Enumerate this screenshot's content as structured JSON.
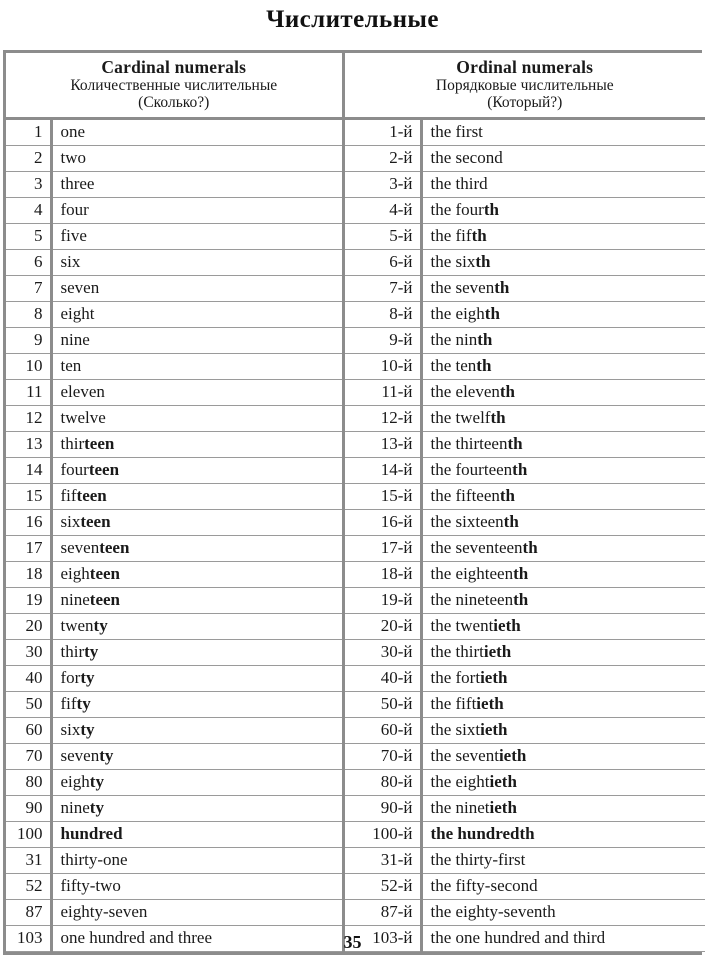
{
  "title": "Числительные",
  "page_number": "35",
  "colors": {
    "border_outer": "#8c8c8c",
    "border_inner": "#9a9a9a",
    "text": "#1a1a1a",
    "background": "#ffffff"
  },
  "table": {
    "headers": {
      "cardinal": {
        "en": "Cardinal numerals",
        "ru": "Количественные числительные",
        "ru_question": "(Сколько?)"
      },
      "ordinal": {
        "en": "Ordinal numerals",
        "ru": "Порядковые числительные",
        "ru_question": "(Который?)"
      }
    },
    "rows": [
      {
        "num": "1",
        "word_plain": "one",
        "word_bold": "",
        "onum": "1-й",
        "oword_plain": "the first",
        "oword_bold": "",
        "all_bold": false
      },
      {
        "num": "2",
        "word_plain": "two",
        "word_bold": "",
        "onum": "2-й",
        "oword_plain": "the second",
        "oword_bold": "",
        "all_bold": false
      },
      {
        "num": "3",
        "word_plain": "three",
        "word_bold": "",
        "onum": "3-й",
        "oword_plain": "the third",
        "oword_bold": "",
        "all_bold": false
      },
      {
        "num": "4",
        "word_plain": "four",
        "word_bold": "",
        "onum": "4-й",
        "oword_plain": "the four",
        "oword_bold": "th",
        "all_bold": false
      },
      {
        "num": "5",
        "word_plain": "five",
        "word_bold": "",
        "onum": "5-й",
        "oword_plain": "the fif",
        "oword_bold": "th",
        "all_bold": false
      },
      {
        "num": "6",
        "word_plain": "six",
        "word_bold": "",
        "onum": "6-й",
        "oword_plain": "the six",
        "oword_bold": "th",
        "all_bold": false
      },
      {
        "num": "7",
        "word_plain": "seven",
        "word_bold": "",
        "onum": "7-й",
        "oword_plain": "the seven",
        "oword_bold": "th",
        "all_bold": false
      },
      {
        "num": "8",
        "word_plain": "eight",
        "word_bold": "",
        "onum": "8-й",
        "oword_plain": "the eigh",
        "oword_bold": "th",
        "all_bold": false
      },
      {
        "num": "9",
        "word_plain": "nine",
        "word_bold": "",
        "onum": "9-й",
        "oword_plain": "the nin",
        "oword_bold": "th",
        "all_bold": false
      },
      {
        "num": "10",
        "word_plain": "ten",
        "word_bold": "",
        "onum": "10-й",
        "oword_plain": "the ten",
        "oword_bold": "th",
        "all_bold": false
      },
      {
        "num": "11",
        "word_plain": "eleven",
        "word_bold": "",
        "onum": "11-й",
        "oword_plain": "the eleven",
        "oword_bold": "th",
        "all_bold": false
      },
      {
        "num": "12",
        "word_plain": "twelve",
        "word_bold": "",
        "onum": "12-й",
        "oword_plain": "the twelf",
        "oword_bold": "th",
        "all_bold": false
      },
      {
        "num": "13",
        "word_plain": "thir",
        "word_bold": "teen",
        "onum": "13-й",
        "oword_plain": "the thirteen",
        "oword_bold": "th",
        "all_bold": false
      },
      {
        "num": "14",
        "word_plain": "four",
        "word_bold": "teen",
        "onum": "14-й",
        "oword_plain": "the fourteen",
        "oword_bold": "th",
        "all_bold": false
      },
      {
        "num": "15",
        "word_plain": "fif",
        "word_bold": "teen",
        "onum": "15-й",
        "oword_plain": "the fifteen",
        "oword_bold": "th",
        "all_bold": false
      },
      {
        "num": "16",
        "word_plain": "six",
        "word_bold": "teen",
        "onum": "16-й",
        "oword_plain": "the sixteen",
        "oword_bold": "th",
        "all_bold": false
      },
      {
        "num": "17",
        "word_plain": "seven",
        "word_bold": "teen",
        "onum": "17-й",
        "oword_plain": "the seventeen",
        "oword_bold": "th",
        "all_bold": false
      },
      {
        "num": "18",
        "word_plain": "eigh",
        "word_bold": "teen",
        "onum": "18-й",
        "oword_plain": "the eighteen",
        "oword_bold": "th",
        "all_bold": false
      },
      {
        "num": "19",
        "word_plain": "nine",
        "word_bold": "teen",
        "onum": "19-й",
        "oword_plain": "the nineteen",
        "oword_bold": "th",
        "all_bold": false
      },
      {
        "num": "20",
        "word_plain": "twen",
        "word_bold": "ty",
        "onum": "20-й",
        "oword_plain": "the twent",
        "oword_bold": "ieth",
        "all_bold": false
      },
      {
        "num": "30",
        "word_plain": "thir",
        "word_bold": "ty",
        "onum": "30-й",
        "oword_plain": "the thirt",
        "oword_bold": "ieth",
        "all_bold": false
      },
      {
        "num": "40",
        "word_plain": "for",
        "word_bold": "ty",
        "onum": "40-й",
        "oword_plain": "the fort",
        "oword_bold": "ieth",
        "all_bold": false
      },
      {
        "num": "50",
        "word_plain": "fif",
        "word_bold": "ty",
        "onum": "50-й",
        "oword_plain": "the fift",
        "oword_bold": "ieth",
        "all_bold": false
      },
      {
        "num": "60",
        "word_plain": "six",
        "word_bold": "ty",
        "onum": "60-й",
        "oword_plain": "the sixt",
        "oword_bold": "ieth",
        "all_bold": false
      },
      {
        "num": "70",
        "word_plain": "seven",
        "word_bold": "ty",
        "onum": "70-й",
        "oword_plain": "the sevent",
        "oword_bold": "ieth",
        "all_bold": false
      },
      {
        "num": "80",
        "word_plain": "eigh",
        "word_bold": "ty",
        "onum": "80-й",
        "oword_plain": "the eight",
        "oword_bold": "ieth",
        "all_bold": false
      },
      {
        "num": "90",
        "word_plain": "nine",
        "word_bold": "ty",
        "onum": "90-й",
        "oword_plain": "the ninet",
        "oword_bold": "ieth",
        "all_bold": false
      },
      {
        "num": "100",
        "word_plain": "hundred",
        "word_bold": "",
        "onum": "100-й",
        "oword_plain": "the hundredth",
        "oword_bold": "",
        "all_bold": true
      },
      {
        "num": "31",
        "word_plain": "thirty-one",
        "word_bold": "",
        "onum": "31-й",
        "oword_plain": "the thirty-first",
        "oword_bold": "",
        "all_bold": false
      },
      {
        "num": "52",
        "word_plain": "fifty-two",
        "word_bold": "",
        "onum": "52-й",
        "oword_plain": "the fifty-second",
        "oword_bold": "",
        "all_bold": false
      },
      {
        "num": "87",
        "word_plain": "eighty-seven",
        "word_bold": "",
        "onum": "87-й",
        "oword_plain": "the eighty-seventh",
        "oword_bold": "",
        "all_bold": false
      },
      {
        "num": "103",
        "word_plain": "one hundred and three",
        "word_bold": "",
        "onum": "103-й",
        "oword_plain": "the one hundred and third",
        "oword_bold": "",
        "all_bold": false
      }
    ]
  }
}
